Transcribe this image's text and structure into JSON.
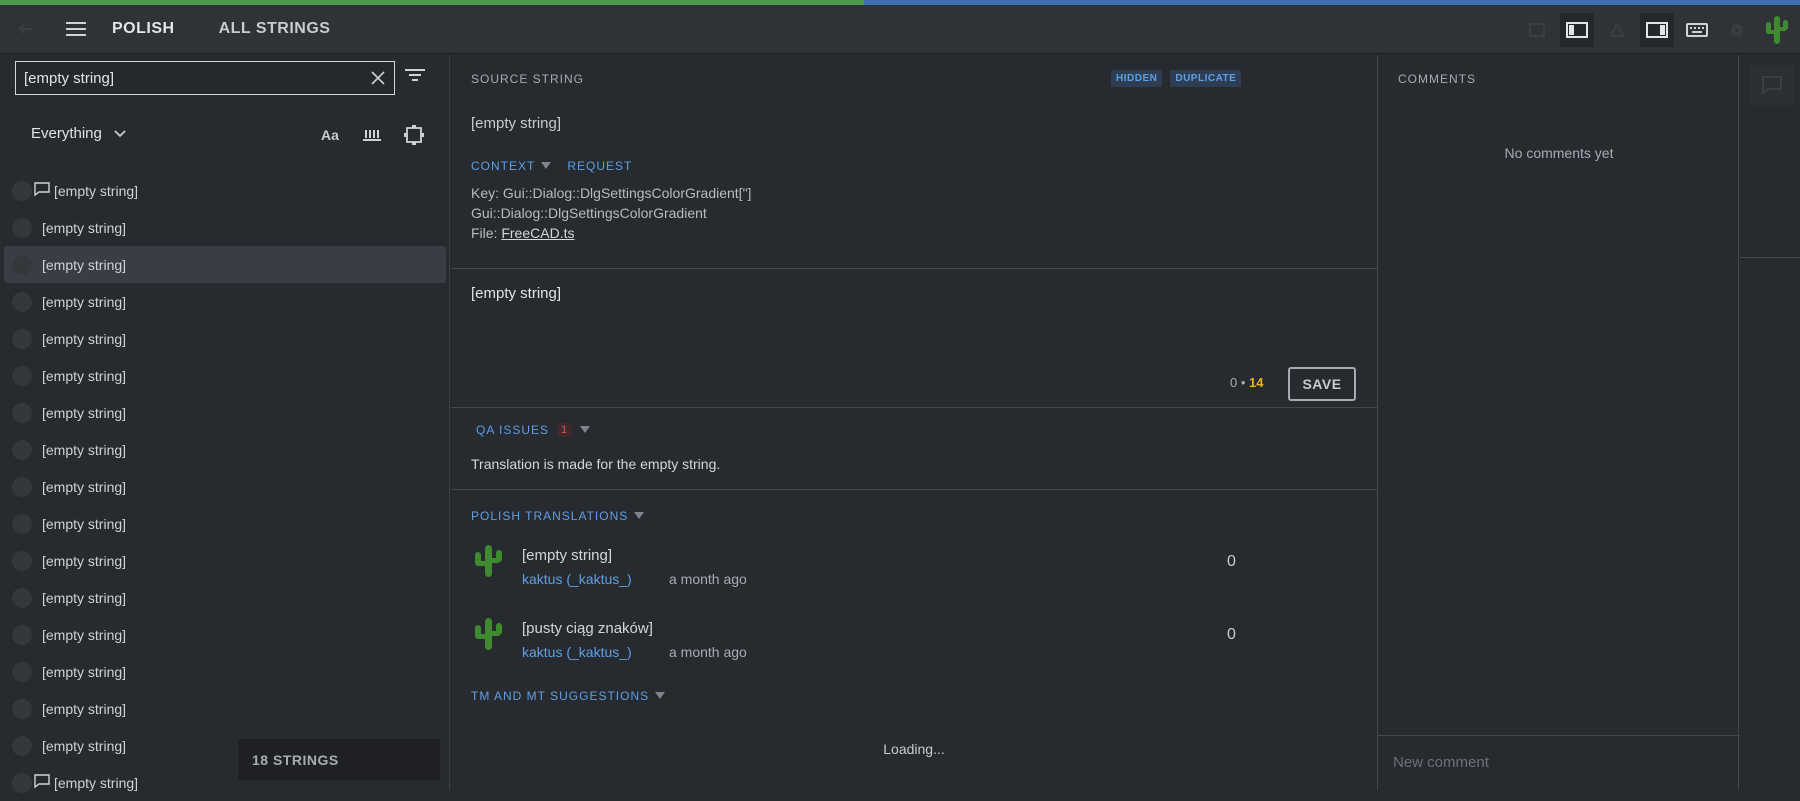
{
  "progress": {
    "fraction": 0.48,
    "done_color": "#4b9a4a",
    "remaining_color": "#3d6fb5"
  },
  "header": {
    "locale": "POLISH",
    "scope": "ALL STRINGS"
  },
  "search": {
    "value": "[empty string]"
  },
  "filter": {
    "selected": "Everything"
  },
  "tools": {
    "case_label": "Aa"
  },
  "strings": [
    {
      "text": "[empty string]",
      "comment": true,
      "selected": false
    },
    {
      "text": "[empty string]",
      "comment": false,
      "selected": false
    },
    {
      "text": "[empty string]",
      "comment": false,
      "selected": true
    },
    {
      "text": "[empty string]",
      "comment": false,
      "selected": false
    },
    {
      "text": "[empty string]",
      "comment": false,
      "selected": false
    },
    {
      "text": "[empty string]",
      "comment": false,
      "selected": false
    },
    {
      "text": "[empty string]",
      "comment": false,
      "selected": false
    },
    {
      "text": "[empty string]",
      "comment": false,
      "selected": false
    },
    {
      "text": "[empty string]",
      "comment": false,
      "selected": false
    },
    {
      "text": "[empty string]",
      "comment": false,
      "selected": false
    },
    {
      "text": "[empty string]",
      "comment": false,
      "selected": false
    },
    {
      "text": "[empty string]",
      "comment": false,
      "selected": false
    },
    {
      "text": "[empty string]",
      "comment": false,
      "selected": false
    },
    {
      "text": "[empty string]",
      "comment": false,
      "selected": false
    },
    {
      "text": "[empty string]",
      "comment": false,
      "selected": false
    },
    {
      "text": "[empty string]",
      "comment": false,
      "selected": false
    },
    {
      "text": "[empty string]",
      "comment": true,
      "selected": false
    }
  ],
  "strings_count": "18 STRINGS",
  "source": {
    "label": "SOURCE STRING",
    "badges": [
      "HIDDEN",
      "DUPLICATE"
    ],
    "text": "[empty string]",
    "context_label": "CONTEXT",
    "request_label": "REQUEST",
    "key_line": "Key: Gui::Dialog::DlgSettingsColorGradient[\"]",
    "context_line": "Gui::Dialog::DlgSettingsColorGradient",
    "file_prefix": "File: ",
    "file_name": "FreeCAD.ts"
  },
  "editor": {
    "value": "[empty string]",
    "count_source": "0",
    "count_sep": "•",
    "count_translation": "14",
    "save_label": "SAVE"
  },
  "qa": {
    "label": "QA ISSUES",
    "count": "1",
    "message": "Translation is made for the empty string."
  },
  "translations": {
    "label": "POLISH TRANSLATIONS",
    "items": [
      {
        "text": "[empty string]",
        "user": "kaktus (_kaktus_)",
        "time": "a month ago",
        "votes": "0"
      },
      {
        "text": "[pusty ciąg znaków]",
        "user": "kaktus (_kaktus_)",
        "time": "a month ago",
        "votes": "0"
      }
    ]
  },
  "suggestions": {
    "label": "TM AND MT SUGGESTIONS",
    "loading": "Loading..."
  },
  "comments": {
    "label": "COMMENTS",
    "empty": "No comments yet",
    "placeholder": "New comment"
  }
}
